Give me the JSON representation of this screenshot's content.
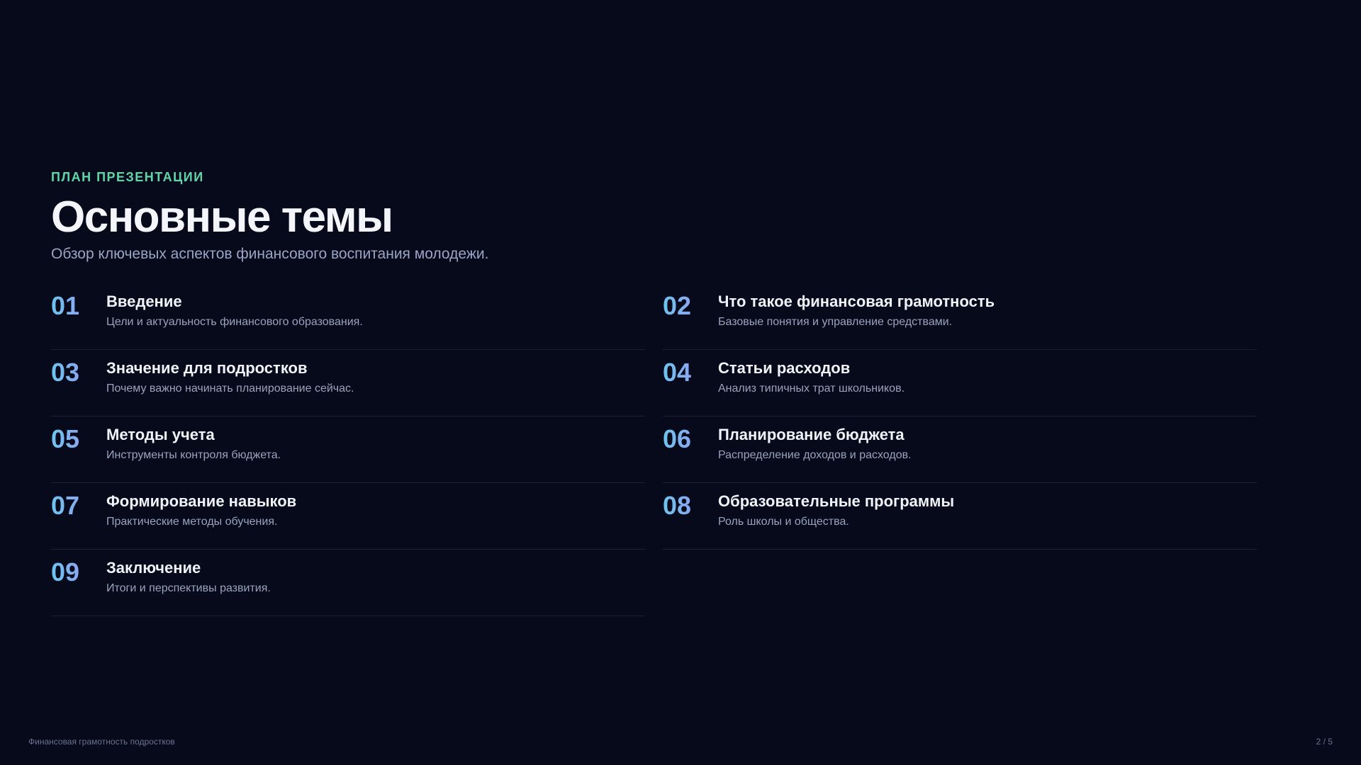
{
  "slide": {
    "eyebrow": "ПЛАН ПРЕЗЕНТАЦИИ",
    "title": "Основные темы",
    "subtitle": "Обзор ключевых аспектов финансового воспитания молодежи."
  },
  "topics": [
    {
      "num": "01",
      "title": "Введение",
      "desc": "Цели и актуальность финансового образования."
    },
    {
      "num": "02",
      "title": "Что такое финансовая грамотность",
      "desc": "Базовые понятия и управление средствами."
    },
    {
      "num": "03",
      "title": "Значение для подростков",
      "desc": "Почему важно начинать планирование сейчас."
    },
    {
      "num": "04",
      "title": "Статьи расходов",
      "desc": "Анализ типичных трат школьников."
    },
    {
      "num": "05",
      "title": "Методы учета",
      "desc": "Инструменты контроля бюджета."
    },
    {
      "num": "06",
      "title": "Планирование бюджета",
      "desc": "Распределение доходов и расходов."
    },
    {
      "num": "07",
      "title": "Формирование навыков",
      "desc": "Практические методы обучения."
    },
    {
      "num": "08",
      "title": "Образовательные программы",
      "desc": "Роль школы и общества."
    },
    {
      "num": "09",
      "title": "Заключение",
      "desc": "Итоги и перспективы развития."
    }
  ],
  "footer": {
    "left": "Финансовая грамотность подростков",
    "page": "2 / 5"
  },
  "colors": {
    "background": "#070a1b",
    "accent": "#5fd6a8",
    "number_gradient_start": "#6cc5ef",
    "number_gradient_end": "#a58cf0"
  }
}
